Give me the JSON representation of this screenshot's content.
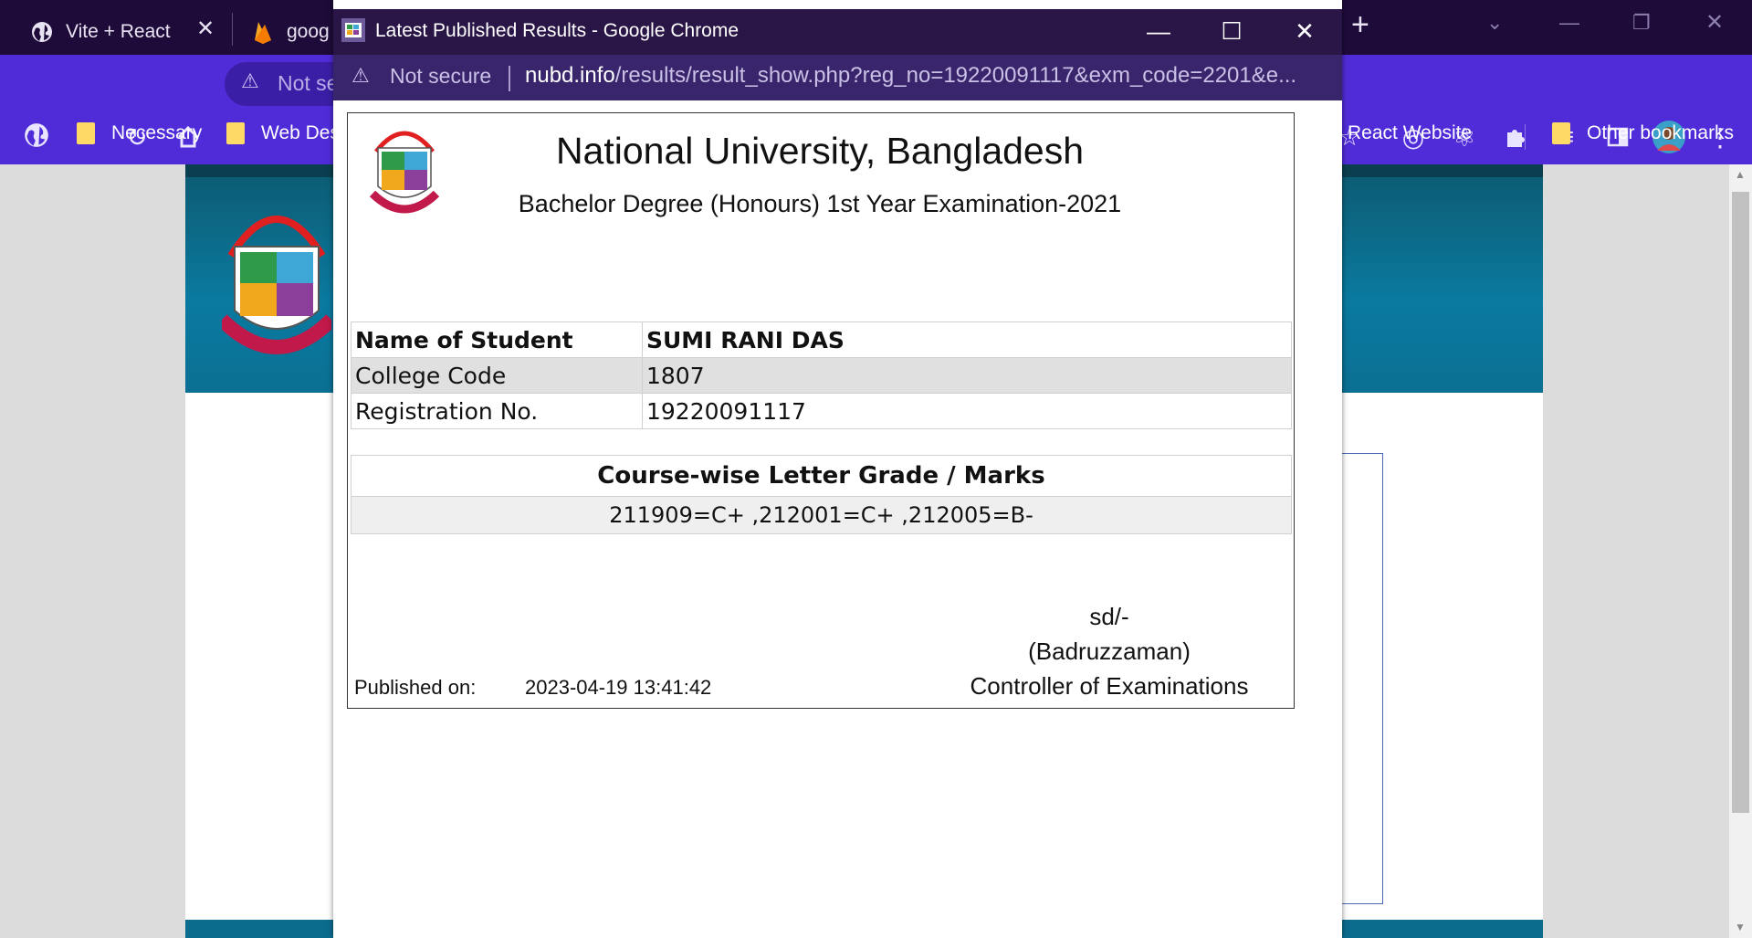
{
  "browser": {
    "tabs": [
      {
        "label": "Vite + React"
      },
      {
        "label": "goog"
      }
    ],
    "omnibox_text": "Not se",
    "bookmarks": [
      {
        "label": "Necessary"
      },
      {
        "label": "Web Des"
      },
      {
        "label": "React Website"
      },
      {
        "label": "Other bookmarks"
      }
    ]
  },
  "popup": {
    "title": "Latest Published Results - Google Chrome",
    "security_label": "Not secure",
    "url_domain": "nubd.info",
    "url_path": "/results/result_show.php?reg_no=19220091117&exm_code=2201&e..."
  },
  "result": {
    "university": "National University, Bangladesh",
    "exam": "Bachelor Degree (Honours) 1st Year Examination-2021",
    "fields": [
      {
        "label": "Name of Student",
        "value": "SUMI RANI DAS"
      },
      {
        "label": "College Code",
        "value": "1807"
      },
      {
        "label": "Registration No.",
        "value": "19220091117"
      }
    ],
    "grades_heading": "Course-wise Letter Grade / Marks",
    "grades": "211909=C+ ,212001=C+ ,212005=B-",
    "signature": "sd/-",
    "signatory": "(Badruzzaman)",
    "signatory_title": "Controller of Examinations",
    "published_label": "Published on:",
    "published_on": "2023-04-19 13:41:42"
  },
  "colors": {
    "tab_bar": "#1e0b3a",
    "toolbar": "#4f2cd8",
    "popup_title_bar": "#2a1547",
    "page_header": "#0a7aa0"
  }
}
